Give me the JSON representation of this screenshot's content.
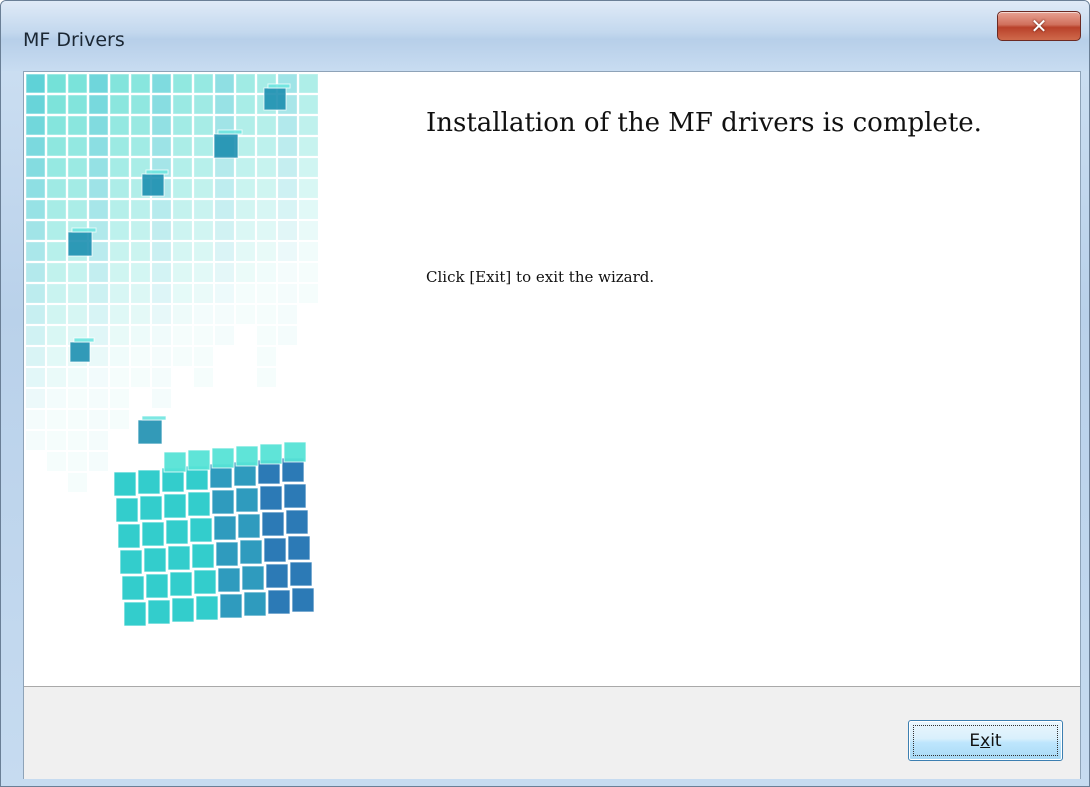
{
  "window": {
    "title": "MF Drivers",
    "close_glyph": "✕"
  },
  "main": {
    "heading": "Installation of the MF drivers is complete.",
    "message": "Click [Exit] to exit the wizard."
  },
  "footer": {
    "exit_label": "Exit"
  },
  "colors": {
    "accent_cyan": "#2fd0c6",
    "close_red": "#c8503a",
    "button_blue": "#3c7fb1"
  },
  "icons": {
    "close": "close-icon",
    "art": "cube-graphic"
  }
}
